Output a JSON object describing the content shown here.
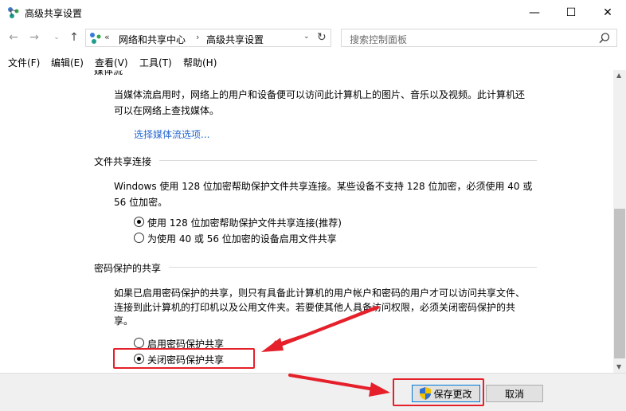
{
  "window": {
    "title": "高级共享设置",
    "minimize": "—",
    "maximize": "☐",
    "close": "✕"
  },
  "nav": {
    "back": "←",
    "forward": "→",
    "recent": "⌄",
    "up": "↑"
  },
  "address": {
    "chevron": "«",
    "crumb1": "网络和共享中心",
    "separator": "›",
    "crumb2": "高级共享设置",
    "dropdown": "⌄",
    "refresh": "↻"
  },
  "search": {
    "placeholder": "搜索控制面板"
  },
  "menu": {
    "file": "文件(F)",
    "edit": "编辑(E)",
    "view": "查看(V)",
    "tools": "工具(T)",
    "help": "帮助(H)"
  },
  "media": {
    "heading_clipped": "媒体流",
    "desc_line1": "当媒体流启用时，网络上的用户和设备便可以访问此计算机上的图片、音乐以及视频。此计算机还",
    "desc_line2": "可以在网络上查找媒体。",
    "link": "选择媒体流选项..."
  },
  "file_sharing": {
    "heading": "文件共享连接",
    "desc_line1": "Windows 使用 128 位加密帮助保护文件共享连接。某些设备不支持 128 位加密，必须使用 40 或",
    "desc_line2": "56 位加密。",
    "option1": "使用 128 位加密帮助保护文件共享连接(推荐)",
    "option2": "为使用 40 或 56 位加密的设备启用文件共享"
  },
  "password": {
    "heading": "密码保护的共享",
    "desc_line1": "如果已启用密码保护的共享，则只有具备此计算机的用户帐户和密码的用户才可以访问共享文件、",
    "desc_line2": "连接到此计算机的打印机以及公用文件夹。若要使其他人具备访问权限，必须关闭密码保护的共",
    "desc_line3": "享。",
    "option1": "启用密码保护共享",
    "option2": "关闭密码保护共享"
  },
  "scrollbar": {
    "up": "▲",
    "down": "▼"
  },
  "buttons": {
    "save": "保存更改",
    "cancel": "取消"
  },
  "colors": {
    "link": "#2a6bd1",
    "annotation": "#e5202a"
  }
}
